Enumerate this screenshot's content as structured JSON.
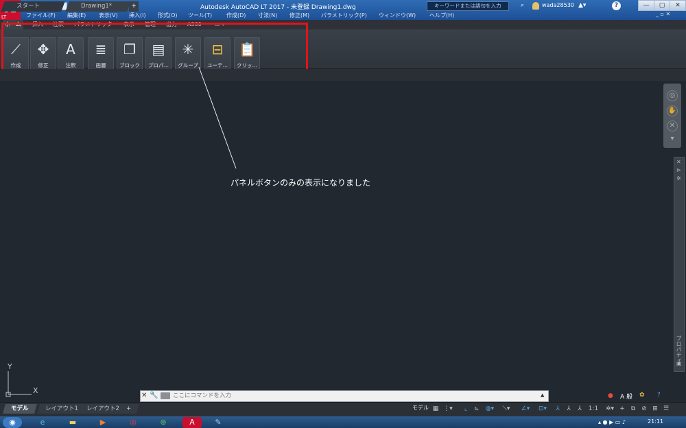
{
  "window": {
    "title": "Autodesk AutoCAD LT 2017 - 未登録   Drawing1.dwg",
    "app_logo": "A",
    "app_logo_sub": "LT",
    "search_placeholder": "キーワードまたは語句を入力",
    "username": "wada28530",
    "minimize": "—",
    "restore": "▢",
    "close": "✕"
  },
  "menu": {
    "items": [
      "ファイル(F)",
      "編集(E)",
      "表示(V)",
      "挿入(I)",
      "形式(O)",
      "ツール(T)",
      "作成(D)",
      "寸法(N)",
      "修正(M)",
      "パラメトリック(P)",
      "ウィンドウ(W)",
      "ヘルプ(H)"
    ],
    "doc_controls": "_ ▫ ✕"
  },
  "ribbon": {
    "tabs": [
      "ホーム",
      "挿入",
      "注釈",
      "パラメトリック",
      "表示",
      "管理",
      "出力",
      "A360",
      "▭ ▾"
    ],
    "active_tab": "ホーム",
    "buttons": [
      {
        "label": "作成",
        "icon": "line-icon"
      },
      {
        "label": "修正",
        "icon": "move-icon"
      },
      {
        "label": "注釈",
        "icon": "text-a-icon"
      },
      {
        "label": "画層",
        "icon": "layers-icon"
      },
      {
        "label": "ブロック",
        "icon": "block-icon"
      },
      {
        "label": "プロパ…",
        "icon": "properties-icon"
      },
      {
        "label": "グループ",
        "icon": "group-icon"
      },
      {
        "label": "ユーテ…",
        "icon": "measure-icon"
      },
      {
        "label": "クリッ…",
        "icon": "clipboard-icon"
      }
    ]
  },
  "file_tabs": {
    "start": "スタート",
    "drawing": "Drawing1*",
    "plus": "+"
  },
  "canvas": {
    "annotation": "パネルボタンのみの表示になりました",
    "ucs_y": "Y",
    "ucs_x": "X",
    "props_label": "プロパティ"
  },
  "command": {
    "placeholder": "ここにコマンドを入力"
  },
  "layout_tabs": [
    "モデル",
    "レイアウト1",
    "レイアウト2",
    "+"
  ],
  "status": {
    "model": "モデル",
    "scale": "1:1"
  },
  "taskbar": {
    "clock": "21:11"
  },
  "colors": {
    "highlight": "#e0141a",
    "canvas": "#212830",
    "title_bar": "#1d4f96"
  }
}
